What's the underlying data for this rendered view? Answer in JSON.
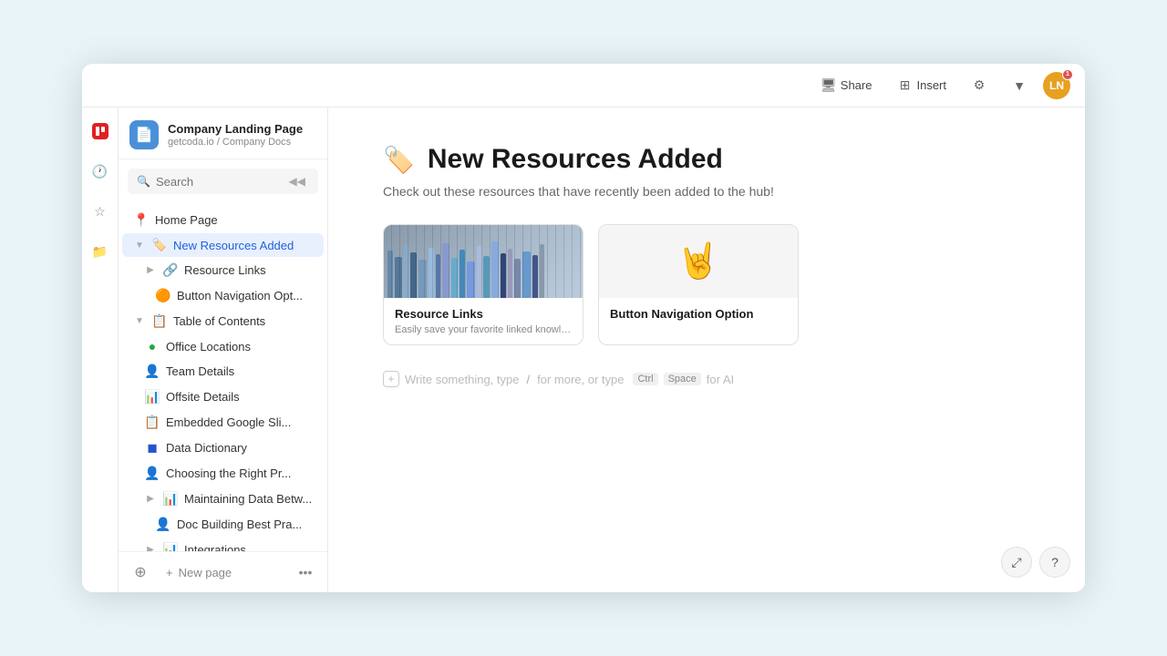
{
  "window": {
    "title": "Company Landing Page"
  },
  "topbar": {
    "share_label": "Share",
    "insert_label": "Insert",
    "user_initials": "LN",
    "notification_count": "1"
  },
  "sidebar": {
    "doc_title": "Company Landing Page",
    "doc_path": "getcoda.io / Company Docs",
    "search_placeholder": "Search",
    "collapse_icon": "◀◀",
    "nav_items": [
      {
        "id": "home",
        "label": "Home Page",
        "icon": "📍",
        "indent": 0,
        "expandable": false,
        "active": false
      },
      {
        "id": "new-resources",
        "label": "New Resources Added",
        "icon": "🏷️",
        "indent": 0,
        "expandable": true,
        "expanded": true,
        "active": true
      },
      {
        "id": "resource-links",
        "label": "Resource Links",
        "icon": "🔗",
        "indent": 1,
        "expandable": true,
        "active": false
      },
      {
        "id": "button-nav",
        "label": "Button Navigation Opt...",
        "icon": "🟠",
        "indent": 2,
        "expandable": false,
        "active": false
      },
      {
        "id": "toc",
        "label": "Table of Contents",
        "icon": "📋",
        "indent": 0,
        "expandable": true,
        "expanded": true,
        "active": false
      },
      {
        "id": "office",
        "label": "Office Locations",
        "icon": "🟢",
        "indent": 1,
        "expandable": false,
        "active": false
      },
      {
        "id": "team",
        "label": "Team Details",
        "icon": "👤",
        "indent": 1,
        "expandable": false,
        "active": false
      },
      {
        "id": "offsite",
        "label": "Offsite Details",
        "icon": "📊",
        "indent": 1,
        "expandable": false,
        "active": false
      },
      {
        "id": "embedded",
        "label": "Embedded Google Sli...",
        "icon": "📋",
        "indent": 1,
        "expandable": false,
        "active": false
      },
      {
        "id": "data-dict",
        "label": "Data Dictionary",
        "icon": "🔵",
        "indent": 1,
        "expandable": false,
        "active": false
      },
      {
        "id": "choosing",
        "label": "Choosing the Right Pr...",
        "icon": "👤",
        "indent": 1,
        "expandable": false,
        "active": false
      },
      {
        "id": "maintaining",
        "label": "Maintaining Data Betw...",
        "icon": "📊",
        "indent": 1,
        "expandable": true,
        "active": false
      },
      {
        "id": "doc-building",
        "label": "Doc Building Best Pra...",
        "icon": "👤",
        "indent": 2,
        "expandable": false,
        "active": false
      },
      {
        "id": "integrations",
        "label": "Integrations",
        "icon": "📊",
        "indent": 1,
        "expandable": true,
        "active": false
      }
    ],
    "new_page_label": "New page"
  },
  "main": {
    "page_emoji": "🏷️",
    "page_title": "New Resources Added",
    "page_subtitle": "Check out these resources that have recently been added to the hub!",
    "cards": [
      {
        "id": "resource-links",
        "title": "Resource Links",
        "description": "Easily save your favorite linked knowledge b...",
        "has_image": true
      },
      {
        "id": "button-nav",
        "title": "Button Navigation Option",
        "description": "",
        "has_image": false,
        "icon": "🤘"
      }
    ],
    "write_hint": "Write something, type",
    "slash_hint": "/",
    "slash_desc": "for more, or type",
    "ctrl_label": "Ctrl",
    "space_label": "Space",
    "ai_label": "for AI"
  },
  "icons": {
    "search": "🔍",
    "clock": "🕐",
    "star": "☆",
    "folder": "📁",
    "plus": "+",
    "more": "•••",
    "share": "🖥",
    "insert": "⊞",
    "settings": "⚙",
    "expand": "⤢",
    "question": "?",
    "chevron_right": "▶",
    "chevron_down": "▼",
    "chevron_left": "◀"
  }
}
